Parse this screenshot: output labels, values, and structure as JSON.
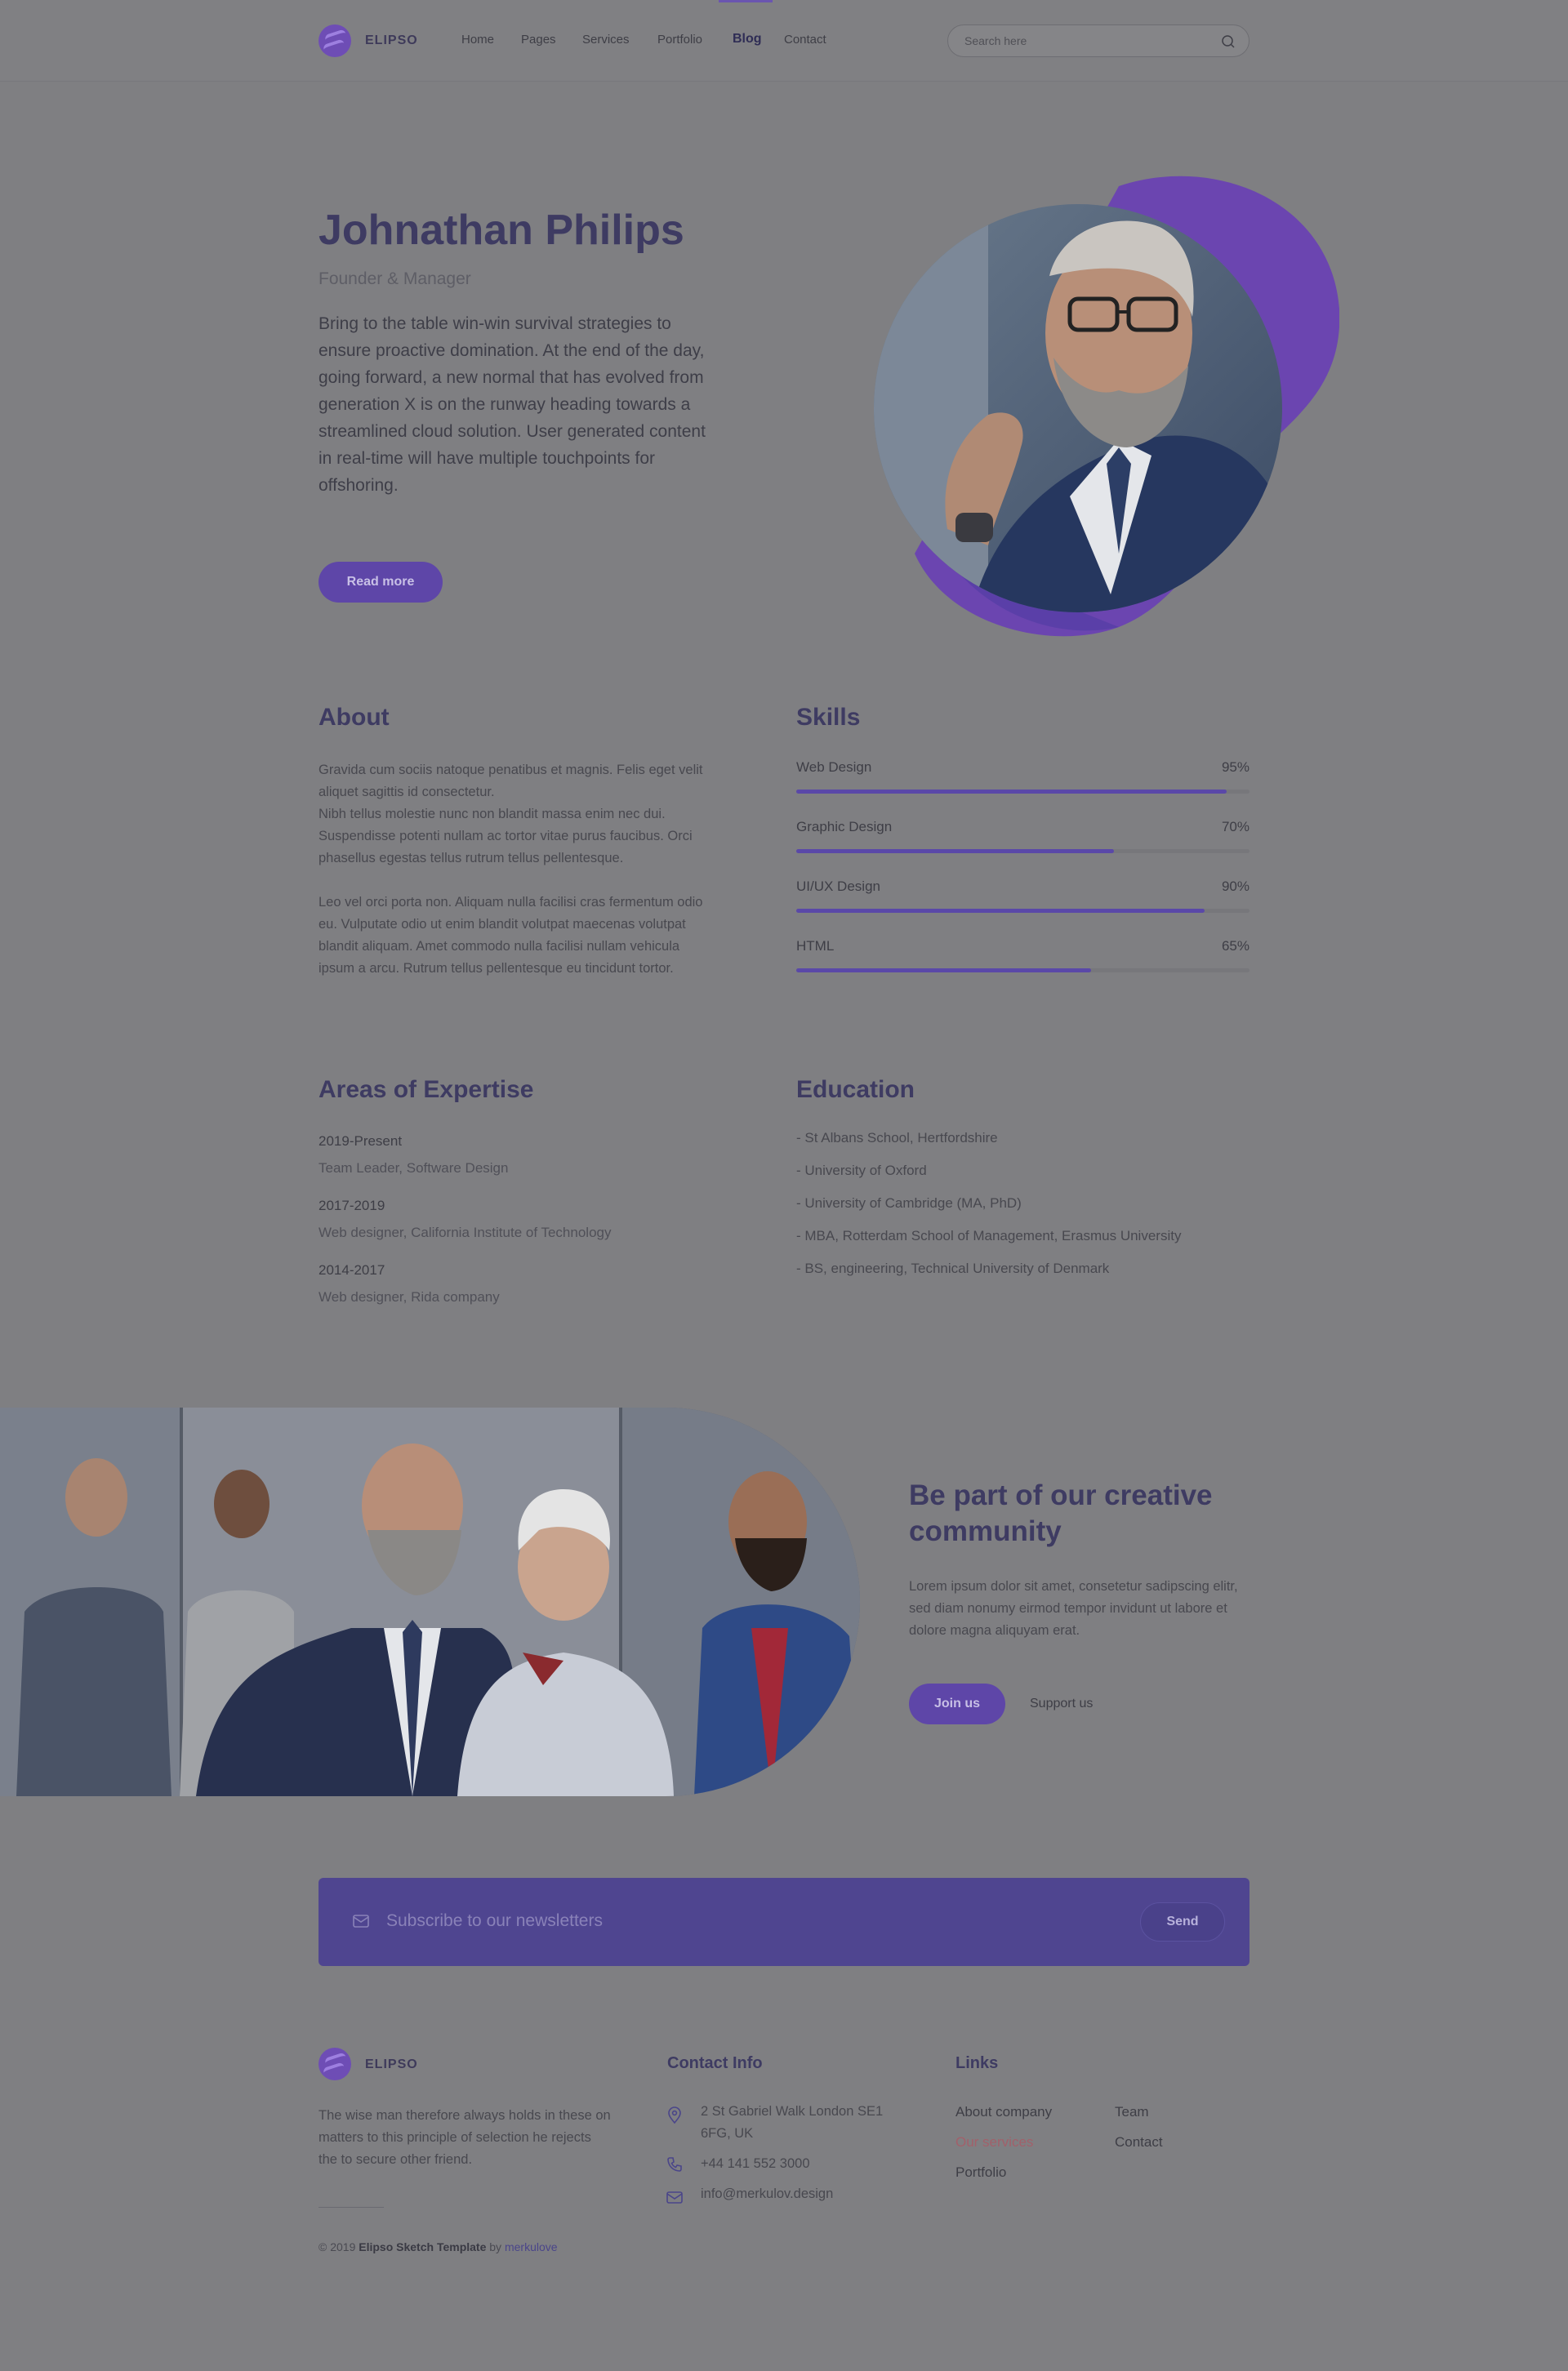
{
  "brand": {
    "name": "ELIPSO"
  },
  "nav": {
    "items": [
      "Home",
      "Pages",
      "Services",
      "Portfolio",
      "Blog",
      "Contact"
    ],
    "active": "Blog"
  },
  "search": {
    "placeholder": "Search here"
  },
  "hero": {
    "name": "Johnathan Philips",
    "role": "Founder & Manager",
    "text": "Bring to the table win-win survival strategies to ensure proactive domination. At the end of the day, going forward, a new normal that has evolved from generation X is on the runway heading towards a streamlined cloud solution. User generated content in real-time will have multiple touchpoints for offshoring.",
    "button": "Read more"
  },
  "about": {
    "title": "About",
    "p1": "Gravida cum sociis natoque penatibus et magnis. Felis eget velit aliquet sagittis id consectetur.\nNibh tellus molestie nunc non blandit massa enim nec dui. Suspendisse potenti nullam ac tortor vitae purus faucibus. Orci phasellus egestas tellus rutrum tellus pellentesque.",
    "p2": "Leo vel orci porta non. Aliquam nulla facilisi cras fermentum odio eu. Vulputate odio ut enim blandit volutpat maecenas volutpat blandit aliquam. Amet commodo nulla facilisi nullam vehicula ipsum a arcu. Rutrum tellus pellentesque eu tincidunt tortor."
  },
  "skills": {
    "title": "Skills",
    "items": [
      {
        "label": "Web Design",
        "percent": "95%",
        "value": 95
      },
      {
        "label": "Graphic Design",
        "percent": "70%",
        "value": 70
      },
      {
        "label": "UI/UX Design",
        "percent": "90%",
        "value": 90
      },
      {
        "label": "HTML",
        "percent": "65%",
        "value": 65
      }
    ]
  },
  "expertise": {
    "title": "Areas of Expertise",
    "items": [
      {
        "years": "2019-Present",
        "role": "Team Leader, Software Design"
      },
      {
        "years": "2017-2019",
        "role": "Web designer, California Institute of Technology"
      },
      {
        "years": "2014-2017",
        "role": "Web designer, Rida company"
      }
    ]
  },
  "education": {
    "title": "Education",
    "items": [
      "- St Albans School, Hertfordshire",
      "- University of Oxford",
      "- University of Cambridge (MA, PhD)",
      "- MBA, Rotterdam School of Management, Erasmus University",
      "- BS, engineering, Technical University of Denmark"
    ]
  },
  "community": {
    "title": "Be part of our creative community",
    "text": "Lorem ipsum dolor sit amet, consetetur sadipscing elitr, sed diam nonumy eirmod tempor invidunt ut labore et dolore magna aliquyam erat.",
    "join": "Join us",
    "support": "Support us"
  },
  "newsletter": {
    "placeholder": "Subscribe to our newsletters",
    "send": "Send"
  },
  "footer": {
    "about": "The wise man therefore always holds in these on matters to this principle of selection he rejects the to secure other friend.",
    "contact_title": "Contact Info",
    "address": "2 St Gabriel Walk London SE1 6FG, UK",
    "phone": "+44 141 552 3000",
    "email": "info@merkulov.design",
    "links_title": "Links",
    "links": [
      "About company",
      "Our services",
      "Portfolio",
      "Team",
      "Contact"
    ],
    "copyright_year": "© 2019",
    "copyright_name": "Elipso Sketch Template",
    "copyright_by": "by",
    "copyright_author": "merkulove"
  },
  "colors": {
    "accent": "#5e46a8",
    "background": "#7f7f82",
    "highlight_link": "#a2606a"
  }
}
